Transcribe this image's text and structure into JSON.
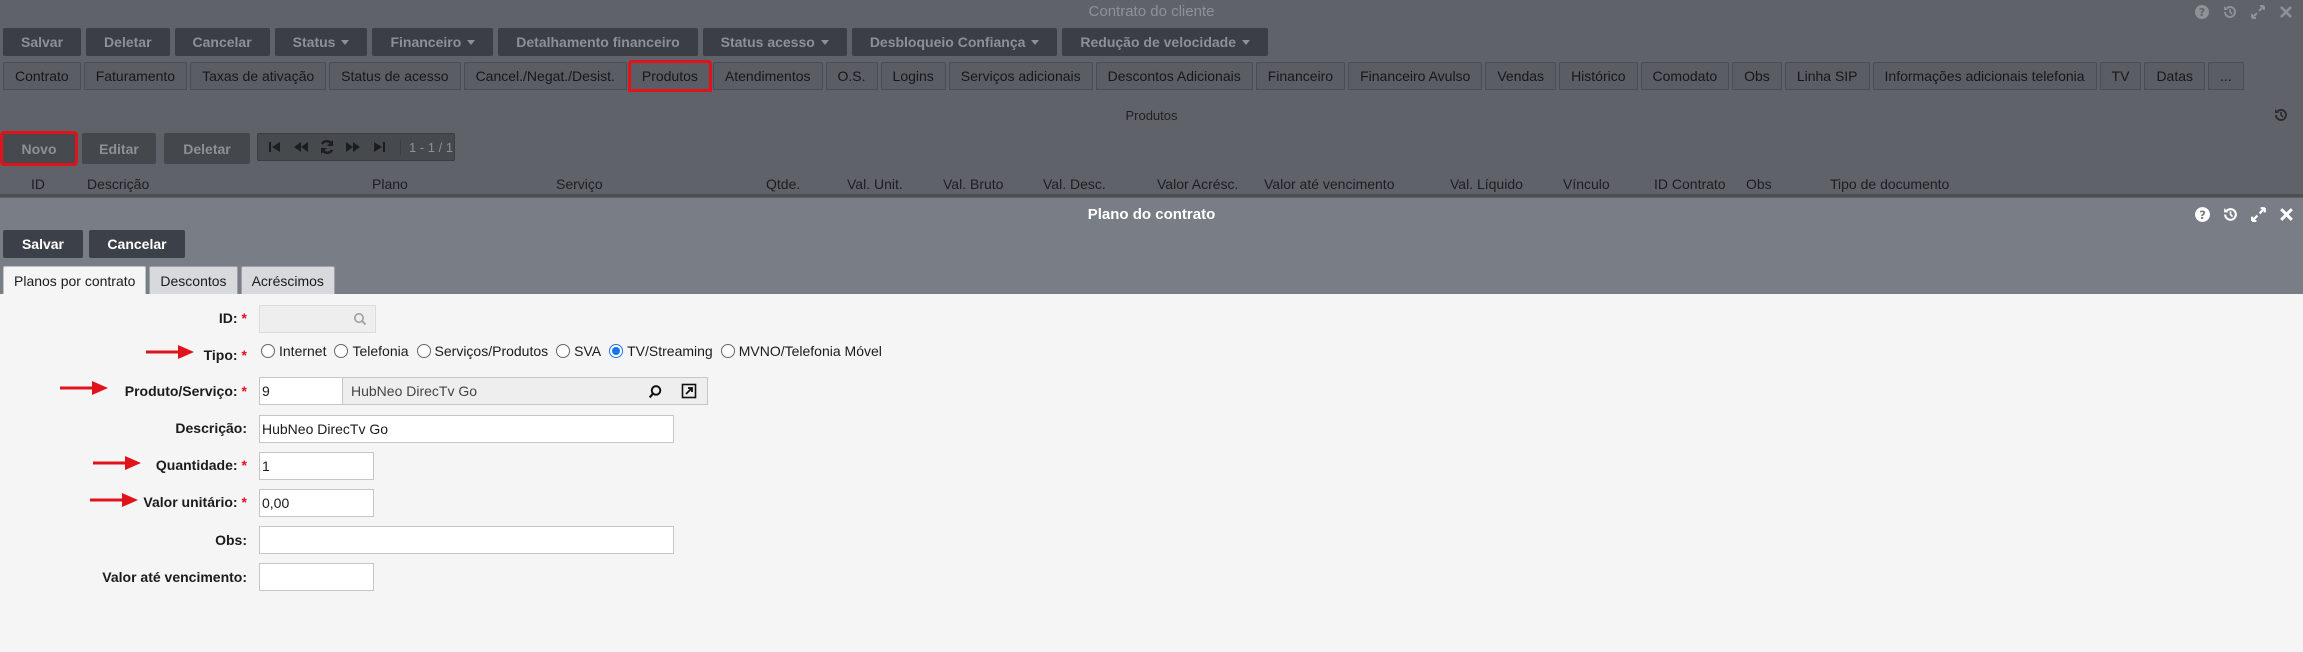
{
  "window1": {
    "title": "Contrato do cliente",
    "toolbar": [
      {
        "label": "Salvar",
        "dropdown": false
      },
      {
        "label": "Deletar",
        "dropdown": false
      },
      {
        "label": "Cancelar",
        "dropdown": false
      },
      {
        "label": "Status",
        "dropdown": true
      },
      {
        "label": "Financeiro",
        "dropdown": true
      },
      {
        "label": "Detalhamento financeiro",
        "dropdown": false
      },
      {
        "label": "Status acesso",
        "dropdown": true
      },
      {
        "label": "Desbloqueio Confiança",
        "dropdown": true
      },
      {
        "label": "Redução de velocidade",
        "dropdown": true
      }
    ],
    "tabs": [
      "Contrato",
      "Faturamento",
      "Taxas de ativação",
      "Status de acesso",
      "Cancel./Negat./Desist.",
      "Produtos",
      "Atendimentos",
      "O.S.",
      "Logins",
      "Serviços adicionais",
      "Descontos Adicionais",
      "Financeiro",
      "Financeiro Avulso",
      "Vendas",
      "Histórico",
      "Comodato",
      "Obs",
      "Linha SIP",
      "Informações adicionais telefonia",
      "TV",
      "Datas",
      "..."
    ],
    "selected_tab": "Produtos",
    "section_label": "Produtos",
    "grid_buttons": {
      "novo": "Novo",
      "editar": "Editar",
      "deletar": "Deletar"
    },
    "pager_text": "1 - 1 / 1",
    "columns": [
      "ID",
      "Descrição",
      "Plano",
      "Serviço",
      "Qtde.",
      "Val. Unit.",
      "Val. Bruto",
      "Val. Desc.",
      "Valor Acrésc.",
      "Valor até vencimento",
      "Val. Líquido",
      "Vínculo",
      "ID Contrato",
      "Obs",
      "Tipo de documento"
    ]
  },
  "window2": {
    "title": "Plano do contrato",
    "buttons": {
      "salvar": "Salvar",
      "cancelar": "Cancelar"
    },
    "tabs": [
      "Planos por contrato",
      "Descontos",
      "Acréscimos"
    ],
    "active_tab": "Planos por contrato",
    "form": {
      "id_label": "ID:",
      "id_value": "",
      "tipo_label": "Tipo:",
      "tipo_options": [
        "Internet",
        "Telefonia",
        "Serviços/Produtos",
        "SVA",
        "TV/Streaming",
        "MVNO/Telefonia Móvel"
      ],
      "tipo_selected": "TV/Streaming",
      "produto_label": "Produto/Serviço:",
      "produto_id": "9",
      "produto_name": "HubNeo DirecTv Go",
      "descricao_label": "Descrição:",
      "descricao_value": "HubNeo DirecTv Go",
      "quantidade_label": "Quantidade:",
      "quantidade_value": "1",
      "valor_unitario_label": "Valor unitário:",
      "valor_unitario_value": "0,00",
      "obs_label": "Obs:",
      "obs_value": "",
      "valor_vencimento_label": "Valor até vencimento:",
      "valor_vencimento_value": ""
    }
  },
  "colors": {
    "highlight": "#e0121a",
    "radio_selected": "#1a73e8",
    "modal_header": "#797e86",
    "dim_background": "#5f6369"
  },
  "icons": [
    "help-icon",
    "history-icon",
    "maximize-icon",
    "close-icon",
    "search-icon",
    "open-external-icon",
    "first-page-icon",
    "prev-page-icon",
    "refresh-icon",
    "next-page-icon",
    "last-page-icon",
    "arrow-right-icon"
  ]
}
